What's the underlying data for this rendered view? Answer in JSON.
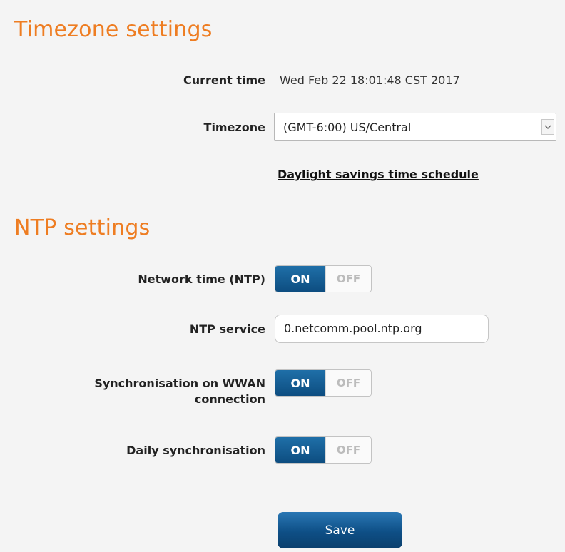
{
  "timezone_section": {
    "title": "Timezone settings",
    "current_time_label": "Current time",
    "current_time_value": "Wed Feb 22 18:01:48 CST 2017",
    "timezone_label": "Timezone",
    "timezone_value": "(GMT-6:00) US/Central",
    "dst_link": "Daylight savings time schedule"
  },
  "ntp_section": {
    "title": "NTP settings",
    "network_time_label": "Network time (NTP)",
    "network_time_on": "ON",
    "network_time_off": "OFF",
    "ntp_service_label": "NTP service",
    "ntp_service_value": "0.netcomm.pool.ntp.org",
    "wwan_sync_label_line1": "Synchronisation on WWAN",
    "wwan_sync_label_line2": "connection",
    "wwan_sync_on": "ON",
    "wwan_sync_off": "OFF",
    "daily_sync_label": "Daily synchronisation",
    "daily_sync_on": "ON",
    "daily_sync_off": "OFF"
  },
  "actions": {
    "save_label": "Save"
  },
  "colors": {
    "accent": "#ee7d22",
    "toggle_on": "#0d4d80",
    "background": "#f4f4f4"
  },
  "icons": {
    "select_arrow": "chevron-down-icon"
  }
}
